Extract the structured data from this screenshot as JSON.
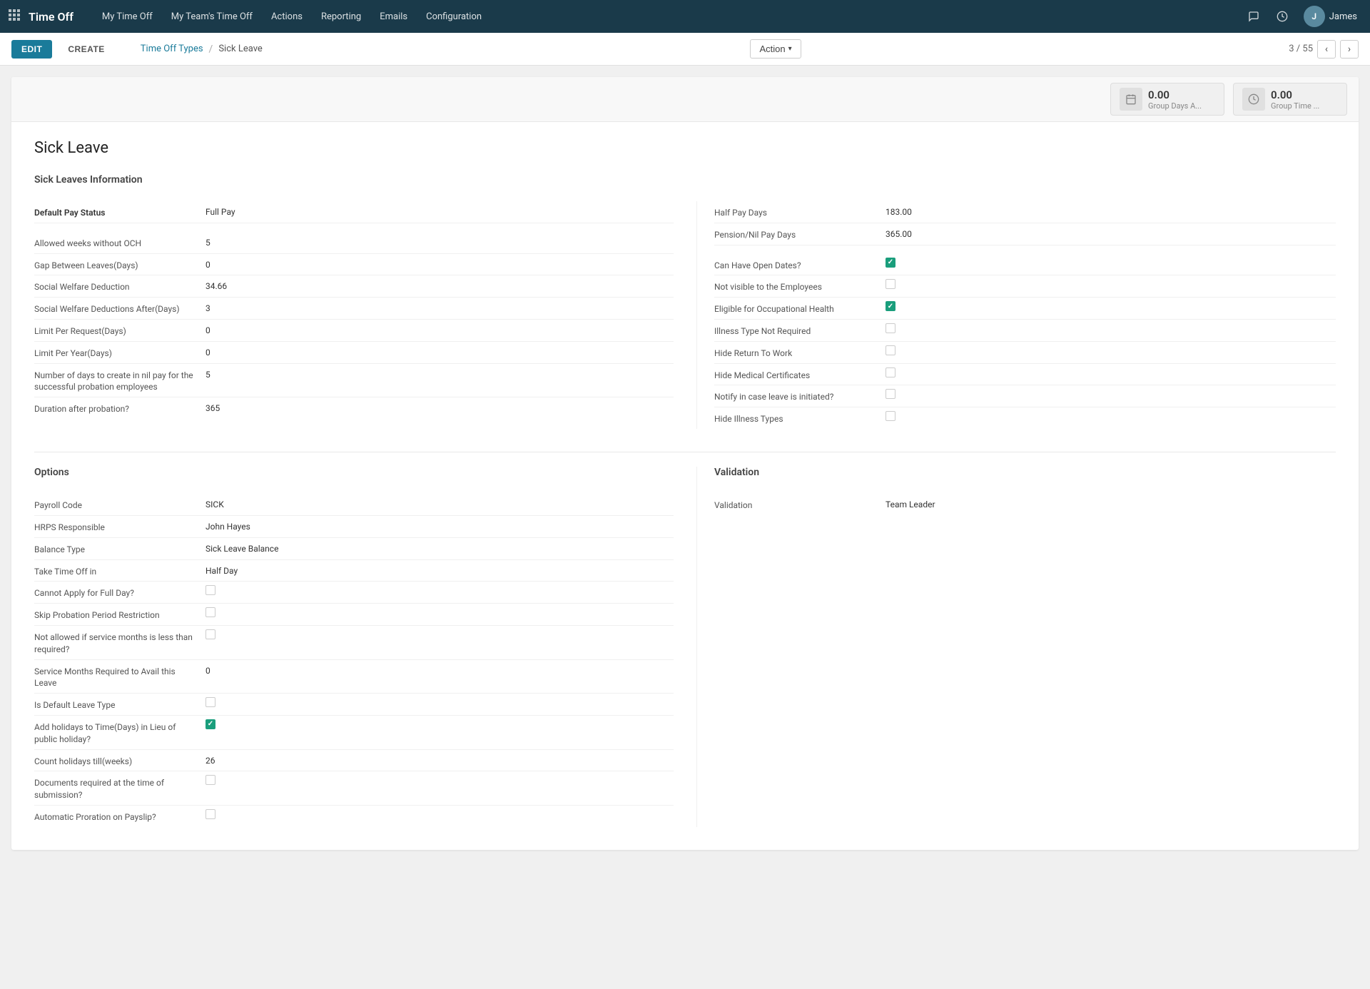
{
  "app": {
    "brand": "Time Off",
    "nav_items": [
      "My Time Off",
      "My Team's Time Off",
      "Actions",
      "Reporting",
      "Emails",
      "Configuration"
    ],
    "user_name": "James",
    "user_initials": "J"
  },
  "toolbar": {
    "edit_label": "EDIT",
    "create_label": "CREATE",
    "action_label": "Action",
    "breadcrumb_parent": "Time Off Types",
    "breadcrumb_current": "Sick Leave",
    "pagination": "3 / 55"
  },
  "stats": [
    {
      "value": "0.00",
      "label": "Group Days A..."
    },
    {
      "value": "0.00",
      "label": "Group Time ..."
    }
  ],
  "record": {
    "title": "Sick Leave",
    "section_info": "Sick Leaves Information",
    "fields_left": [
      {
        "label": "Default Pay Status",
        "value": "Full Pay",
        "bold": true,
        "type": "text"
      },
      {
        "label": "",
        "value": "",
        "type": "spacer"
      },
      {
        "label": "Allowed weeks without OCH",
        "value": "5",
        "type": "text"
      },
      {
        "label": "Gap Between Leaves(Days)",
        "value": "0",
        "type": "text"
      },
      {
        "label": "Social Welfare Deduction",
        "value": "34.66",
        "type": "text"
      },
      {
        "label": "Social Welfare Deductions After(Days)",
        "value": "3",
        "type": "text"
      },
      {
        "label": "Limit Per Request(Days)",
        "value": "0",
        "type": "text"
      },
      {
        "label": "Limit Per Year(Days)",
        "value": "0",
        "type": "text"
      },
      {
        "label": "Number of days to create in nil pay for the successful probation employees",
        "value": "5",
        "type": "text"
      },
      {
        "label": "Duration after probation?",
        "value": "365",
        "type": "text"
      }
    ],
    "fields_right": [
      {
        "label": "Half Pay Days",
        "value": "183.00",
        "type": "text"
      },
      {
        "label": "Pension/Nil Pay Days",
        "value": "365.00",
        "type": "text"
      },
      {
        "label": "",
        "value": "",
        "type": "spacer"
      },
      {
        "label": "Can Have Open Dates?",
        "value": "",
        "type": "checkbox",
        "checked": true
      },
      {
        "label": "Not visible to the Employees",
        "value": "",
        "type": "checkbox",
        "checked": false
      },
      {
        "label": "Eligible for Occupational Health",
        "value": "",
        "type": "checkbox",
        "checked": true
      },
      {
        "label": "Illness Type Not Required",
        "value": "",
        "type": "checkbox",
        "checked": false
      },
      {
        "label": "Hide Return To Work",
        "value": "",
        "type": "checkbox",
        "checked": false
      },
      {
        "label": "Hide Medical Certificates",
        "value": "",
        "type": "checkbox",
        "checked": false
      },
      {
        "label": "Notify in case leave is initiated?",
        "value": "",
        "type": "checkbox",
        "checked": false
      },
      {
        "label": "Hide Illness Types",
        "value": "",
        "type": "checkbox",
        "checked": false
      }
    ],
    "section_options": "Options",
    "options_fields": [
      {
        "label": "Payroll Code",
        "value": "SICK",
        "type": "text"
      },
      {
        "label": "HRPS Responsible",
        "value": "John Hayes",
        "type": "text"
      },
      {
        "label": "Balance Type",
        "value": "Sick Leave Balance",
        "type": "text"
      },
      {
        "label": "Take Time Off in",
        "value": "Half Day",
        "type": "text"
      },
      {
        "label": "Cannot Apply for Full Day?",
        "value": "",
        "type": "checkbox",
        "checked": false
      },
      {
        "label": "Skip Probation Period Restriction",
        "value": "",
        "type": "checkbox",
        "checked": false
      },
      {
        "label": "Not allowed if service months is less than required?",
        "value": "",
        "type": "checkbox",
        "checked": false
      },
      {
        "label": "Service Months Required to Avail this Leave",
        "value": "0",
        "type": "text"
      },
      {
        "label": "Is Default Leave Type",
        "value": "",
        "type": "checkbox",
        "checked": false
      },
      {
        "label": "Add holidays to Time(Days) in Lieu of public holiday?",
        "value": "",
        "type": "checkbox",
        "checked": true
      },
      {
        "label": "Count holidays till(weeks)",
        "value": "26",
        "type": "text"
      },
      {
        "label": "Documents required at the time of submission?",
        "value": "",
        "type": "checkbox",
        "checked": false
      },
      {
        "label": "Automatic Proration on Payslip?",
        "value": "",
        "type": "checkbox",
        "checked": false
      }
    ],
    "section_validation": "Validation",
    "validation_fields": [
      {
        "label": "Validation",
        "value": "Team Leader",
        "type": "text"
      }
    ]
  }
}
